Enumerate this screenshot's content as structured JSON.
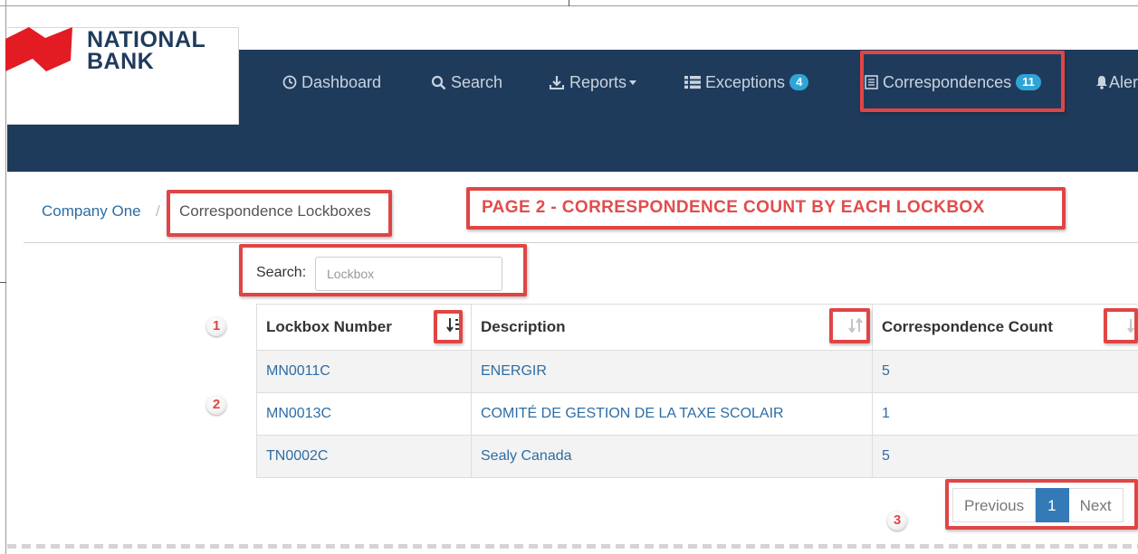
{
  "brand": {
    "line1": "NATIONAL",
    "line2": "BANK",
    "logo_color": "#e31b23"
  },
  "nav": {
    "bg_color": "#1f3b5c",
    "badge_color": "#2fa4d6",
    "items": [
      {
        "label": "Dashboard",
        "icon": "dashboard-icon"
      },
      {
        "label": "Search",
        "icon": "search-icon"
      },
      {
        "label": "Reports",
        "icon": "download-icon",
        "dropdown": true
      },
      {
        "label": "Exceptions",
        "icon": "list-icon",
        "badge": "4"
      },
      {
        "label": "Correspondences",
        "icon": "document-icon",
        "badge": "11"
      },
      {
        "label": "Aler",
        "icon": "bell-icon"
      }
    ]
  },
  "breadcrumb": {
    "root": "Company One",
    "separator": "/",
    "current": "Correspondence Lockboxes"
  },
  "annotation": {
    "title": "PAGE 2 - CORRESPONDENCE COUNT BY EACH LOCKBOX",
    "color": "#e04545",
    "markers": [
      "1",
      "2",
      "3"
    ]
  },
  "search": {
    "label": "Search:",
    "placeholder": "Lockbox"
  },
  "table": {
    "columns": [
      "Lockbox Number",
      "Description",
      "Correspondence Count"
    ],
    "rows": [
      [
        "MN0011C",
        "ENERGIR",
        "5"
      ],
      [
        "MN0013C",
        "COMITÉ DE GESTION DE LA TAXE SCOLAIR",
        "1"
      ],
      [
        "TN0002C",
        "Sealy Canada",
        "5"
      ]
    ]
  },
  "pagination": {
    "previous": "Previous",
    "current_page": "1",
    "next": "Next",
    "active_color": "#337ab7"
  }
}
